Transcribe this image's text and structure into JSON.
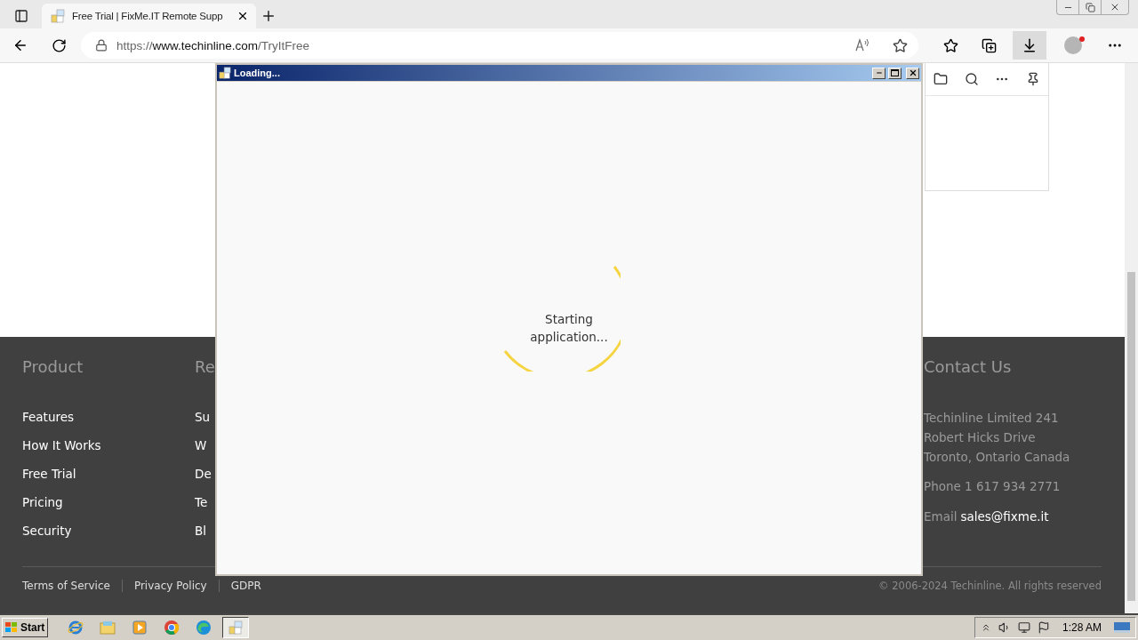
{
  "browser": {
    "tabs": [
      {
        "title": "Free Trial | FixMe.IT Remote Supp",
        "selected": true
      }
    ],
    "address": {
      "scheme": "https://",
      "domain": "www.techinline.com",
      "path": "/TryItFree"
    }
  },
  "footer": {
    "columns": [
      {
        "heading": "Product",
        "links": [
          "Features",
          "How It Works",
          "Free Trial",
          "Pricing",
          "Security"
        ]
      },
      {
        "heading": "Re",
        "links": [
          "Su",
          "W",
          "De",
          "Te",
          "Bl"
        ]
      }
    ],
    "contact": {
      "heading": "Contact Us",
      "address_lines": [
        "Techinline Limited 241",
        "Robert Hicks Drive",
        "Toronto, Ontario Canada"
      ],
      "phone": "Phone 1 617 934 2771",
      "email_label": "Email",
      "email": "sales@fixme.it"
    },
    "legal_links": [
      "Terms of Service",
      "Privacy Policy",
      "GDPR"
    ],
    "copyright": "© 2006-2024 Techinline. All rights reserved"
  },
  "dialog": {
    "title": "Loading...",
    "message": "Starting application..."
  },
  "taskbar": {
    "start": "Start",
    "apps": [
      {
        "kind": "ie",
        "selected": false
      },
      {
        "kind": "explorer",
        "selected": false
      },
      {
        "kind": "media",
        "selected": false
      },
      {
        "kind": "chrome",
        "selected": false
      },
      {
        "kind": "edge",
        "selected": false
      },
      {
        "kind": "app",
        "selected": true
      }
    ],
    "clock": "1:28 AM"
  }
}
